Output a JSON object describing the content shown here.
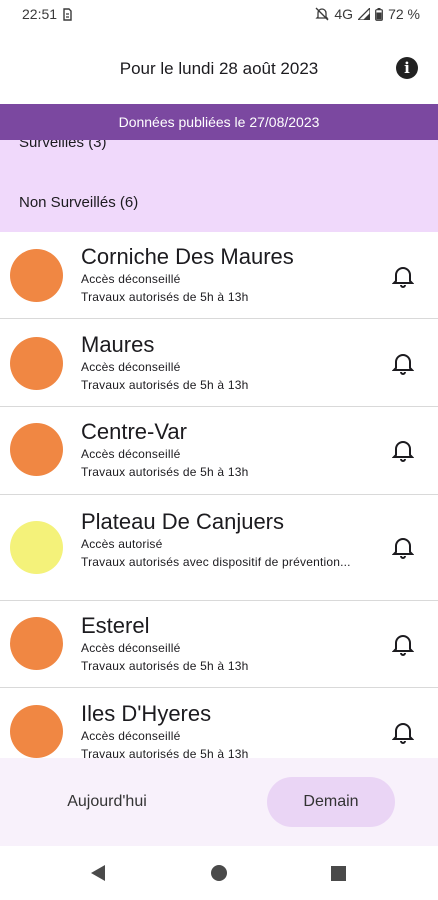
{
  "status_bar": {
    "time": "22:51",
    "network": "4G",
    "battery": "72 %"
  },
  "header": {
    "title": "Pour le lundi 28 août 2023",
    "info_icon": "info-icon"
  },
  "banner": {
    "text": "Données publiées le 27/08/2023"
  },
  "groups": {
    "surveilles": "Surveillés (3)",
    "non_surveilles": "Non Surveillés (6)"
  },
  "colors": {
    "orange": "#f08743",
    "yellow": "#f4f27a",
    "banner": "#7b48a0",
    "group_bg": "#f0d9fb"
  },
  "massifs": [
    {
      "name": "Corniche Des Maures",
      "access": "Accès déconseillé",
      "works": "Travaux autorisés de 5h à 13h",
      "level": "orange"
    },
    {
      "name": "Maures",
      "access": "Accès déconseillé",
      "works": "Travaux autorisés de 5h à 13h",
      "level": "orange"
    },
    {
      "name": "Centre-Var",
      "access": "Accès déconseillé",
      "works": "Travaux autorisés de 5h à 13h",
      "level": "orange"
    },
    {
      "name": "Plateau De Canjuers",
      "access": "Accès autorisé",
      "works": "Travaux autorisés avec dispositif de prévention...",
      "level": "yellow"
    },
    {
      "name": "Esterel",
      "access": "Accès déconseillé",
      "works": "Travaux autorisés de 5h à 13h",
      "level": "orange"
    },
    {
      "name": "Iles D'Hyeres",
      "access": "Accès déconseillé",
      "works": "Travaux autorisés de 5h à 13h",
      "level": "orange"
    }
  ],
  "bottom_nav": {
    "today": "Aujourd'hui",
    "tomorrow": "Demain",
    "selected": "tomorrow"
  }
}
